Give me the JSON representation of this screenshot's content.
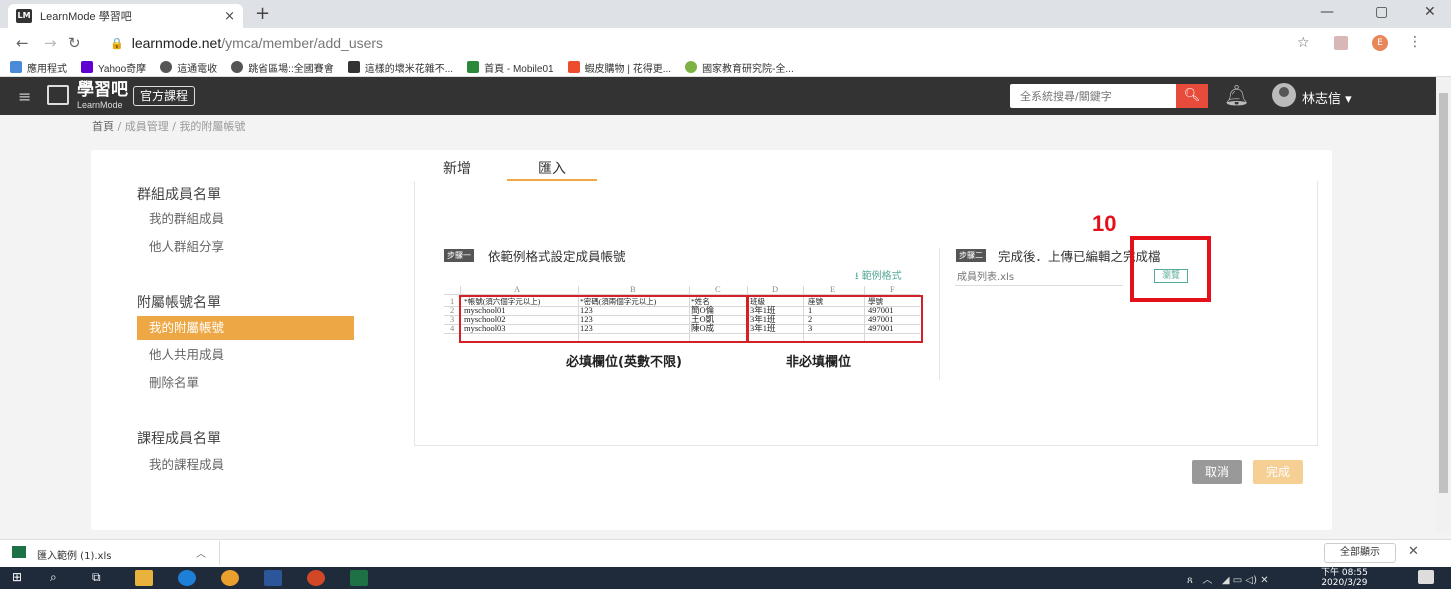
{
  "browser": {
    "tab_title": "LearnMode 學習吧",
    "favicon_text": "LM",
    "url_host": "learnmode.net",
    "url_path": "/ymca/member/add_users",
    "bookmarks": [
      "應用程式",
      "Yahoo奇摩",
      "這通電收",
      "跳省區場::全國賽會",
      "這樣的壞米花雜不...",
      "首頁 - Mobile01",
      "蝦皮購物 | 花得更...",
      "國家教育研究院-全..."
    ]
  },
  "header": {
    "logo_text": "學習吧",
    "logo_sub": "LearnMode",
    "course_button": "官方課程",
    "search_placeholder": "全系統搜尋/關鍵字",
    "username": "林志信 ▾"
  },
  "breadcrumb": {
    "home": "首頁",
    "sep": " / ",
    "item1": "成員管理",
    "item2": "我的附屬帳號"
  },
  "sidebar": {
    "group1": {
      "title": "群組成員名單",
      "items": [
        "我的群組成員",
        "他人群組分享"
      ]
    },
    "group2": {
      "title": "附屬帳號名單",
      "items": [
        "我的附屬帳號",
        "他人共用成員",
        "刪除名單"
      ]
    },
    "group3": {
      "title": "課程成員名單",
      "items": [
        "我的課程成員"
      ]
    }
  },
  "tabs": [
    "新增",
    "匯入"
  ],
  "step1": {
    "badge": "步驟一",
    "title": "依範例格式設定成員帳號",
    "sample_link": "範例格式"
  },
  "sheet": {
    "columns": [
      "A",
      "B",
      "C",
      "D",
      "E",
      "F"
    ],
    "rownums": [
      "1",
      "2",
      "3",
      "4"
    ],
    "header": [
      "*帳號(須六個字元以上)",
      "*密碼(須兩個字元以上)",
      "*姓名",
      "班級",
      "座號",
      "學號"
    ],
    "rows": [
      [
        "myschool01",
        "123",
        "簡O倫",
        "3年1班",
        "1",
        "497001"
      ],
      [
        "myschool02",
        "123",
        "王O凱",
        "3年1班",
        "2",
        "497001"
      ],
      [
        "myschool03",
        "123",
        "陳O成",
        "3年1班",
        "3",
        "497001"
      ]
    ],
    "required_label": "必填欄位(英數不限)",
    "optional_label": "非必填欄位"
  },
  "step2": {
    "badge": "步驟二",
    "title": "完成後．上傳已編輯之完成檔",
    "file_placeholder": "成員列表.xls",
    "browse": "瀏覽"
  },
  "annotation": "10",
  "buttons": {
    "cancel": "取消",
    "finish": "完成"
  },
  "downloads": {
    "file": "匯入範例 (1).xls",
    "show_all": "全部顯示"
  },
  "taskbar": {
    "time": "下午 08:55",
    "date": "2020/3/29"
  }
}
